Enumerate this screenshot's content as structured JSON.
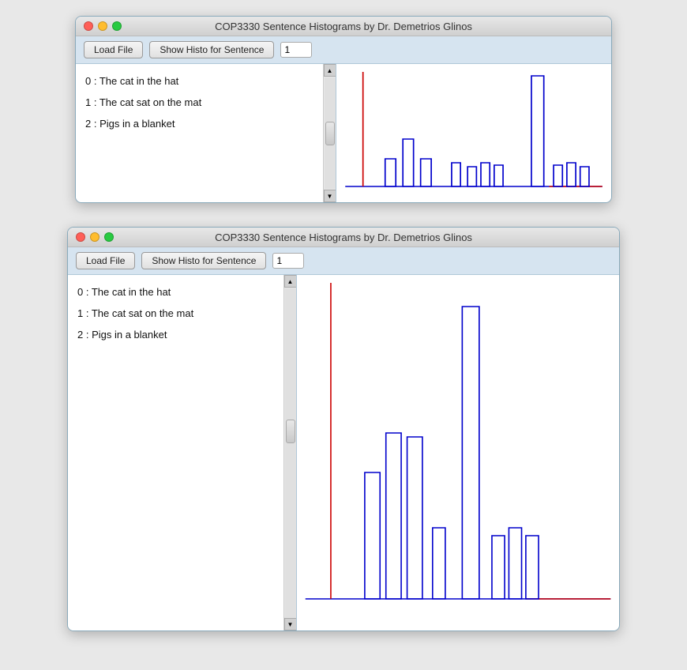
{
  "app": {
    "title": "COP3330 Sentence Histograms by Dr. Demetrios Glinos"
  },
  "toolbar": {
    "load_file_label": "Load File",
    "show_histo_label": "Show Histo for Sentence",
    "sentence_number": "1"
  },
  "sentences": [
    {
      "index": "0",
      "text": "The cat in the hat"
    },
    {
      "index": "1",
      "text": "The cat sat on the mat"
    },
    {
      "index": "2",
      "text": "Pigs in a blanket"
    }
  ],
  "scrollbar": {
    "up_arrow": "▲",
    "down_arrow": "▼"
  }
}
